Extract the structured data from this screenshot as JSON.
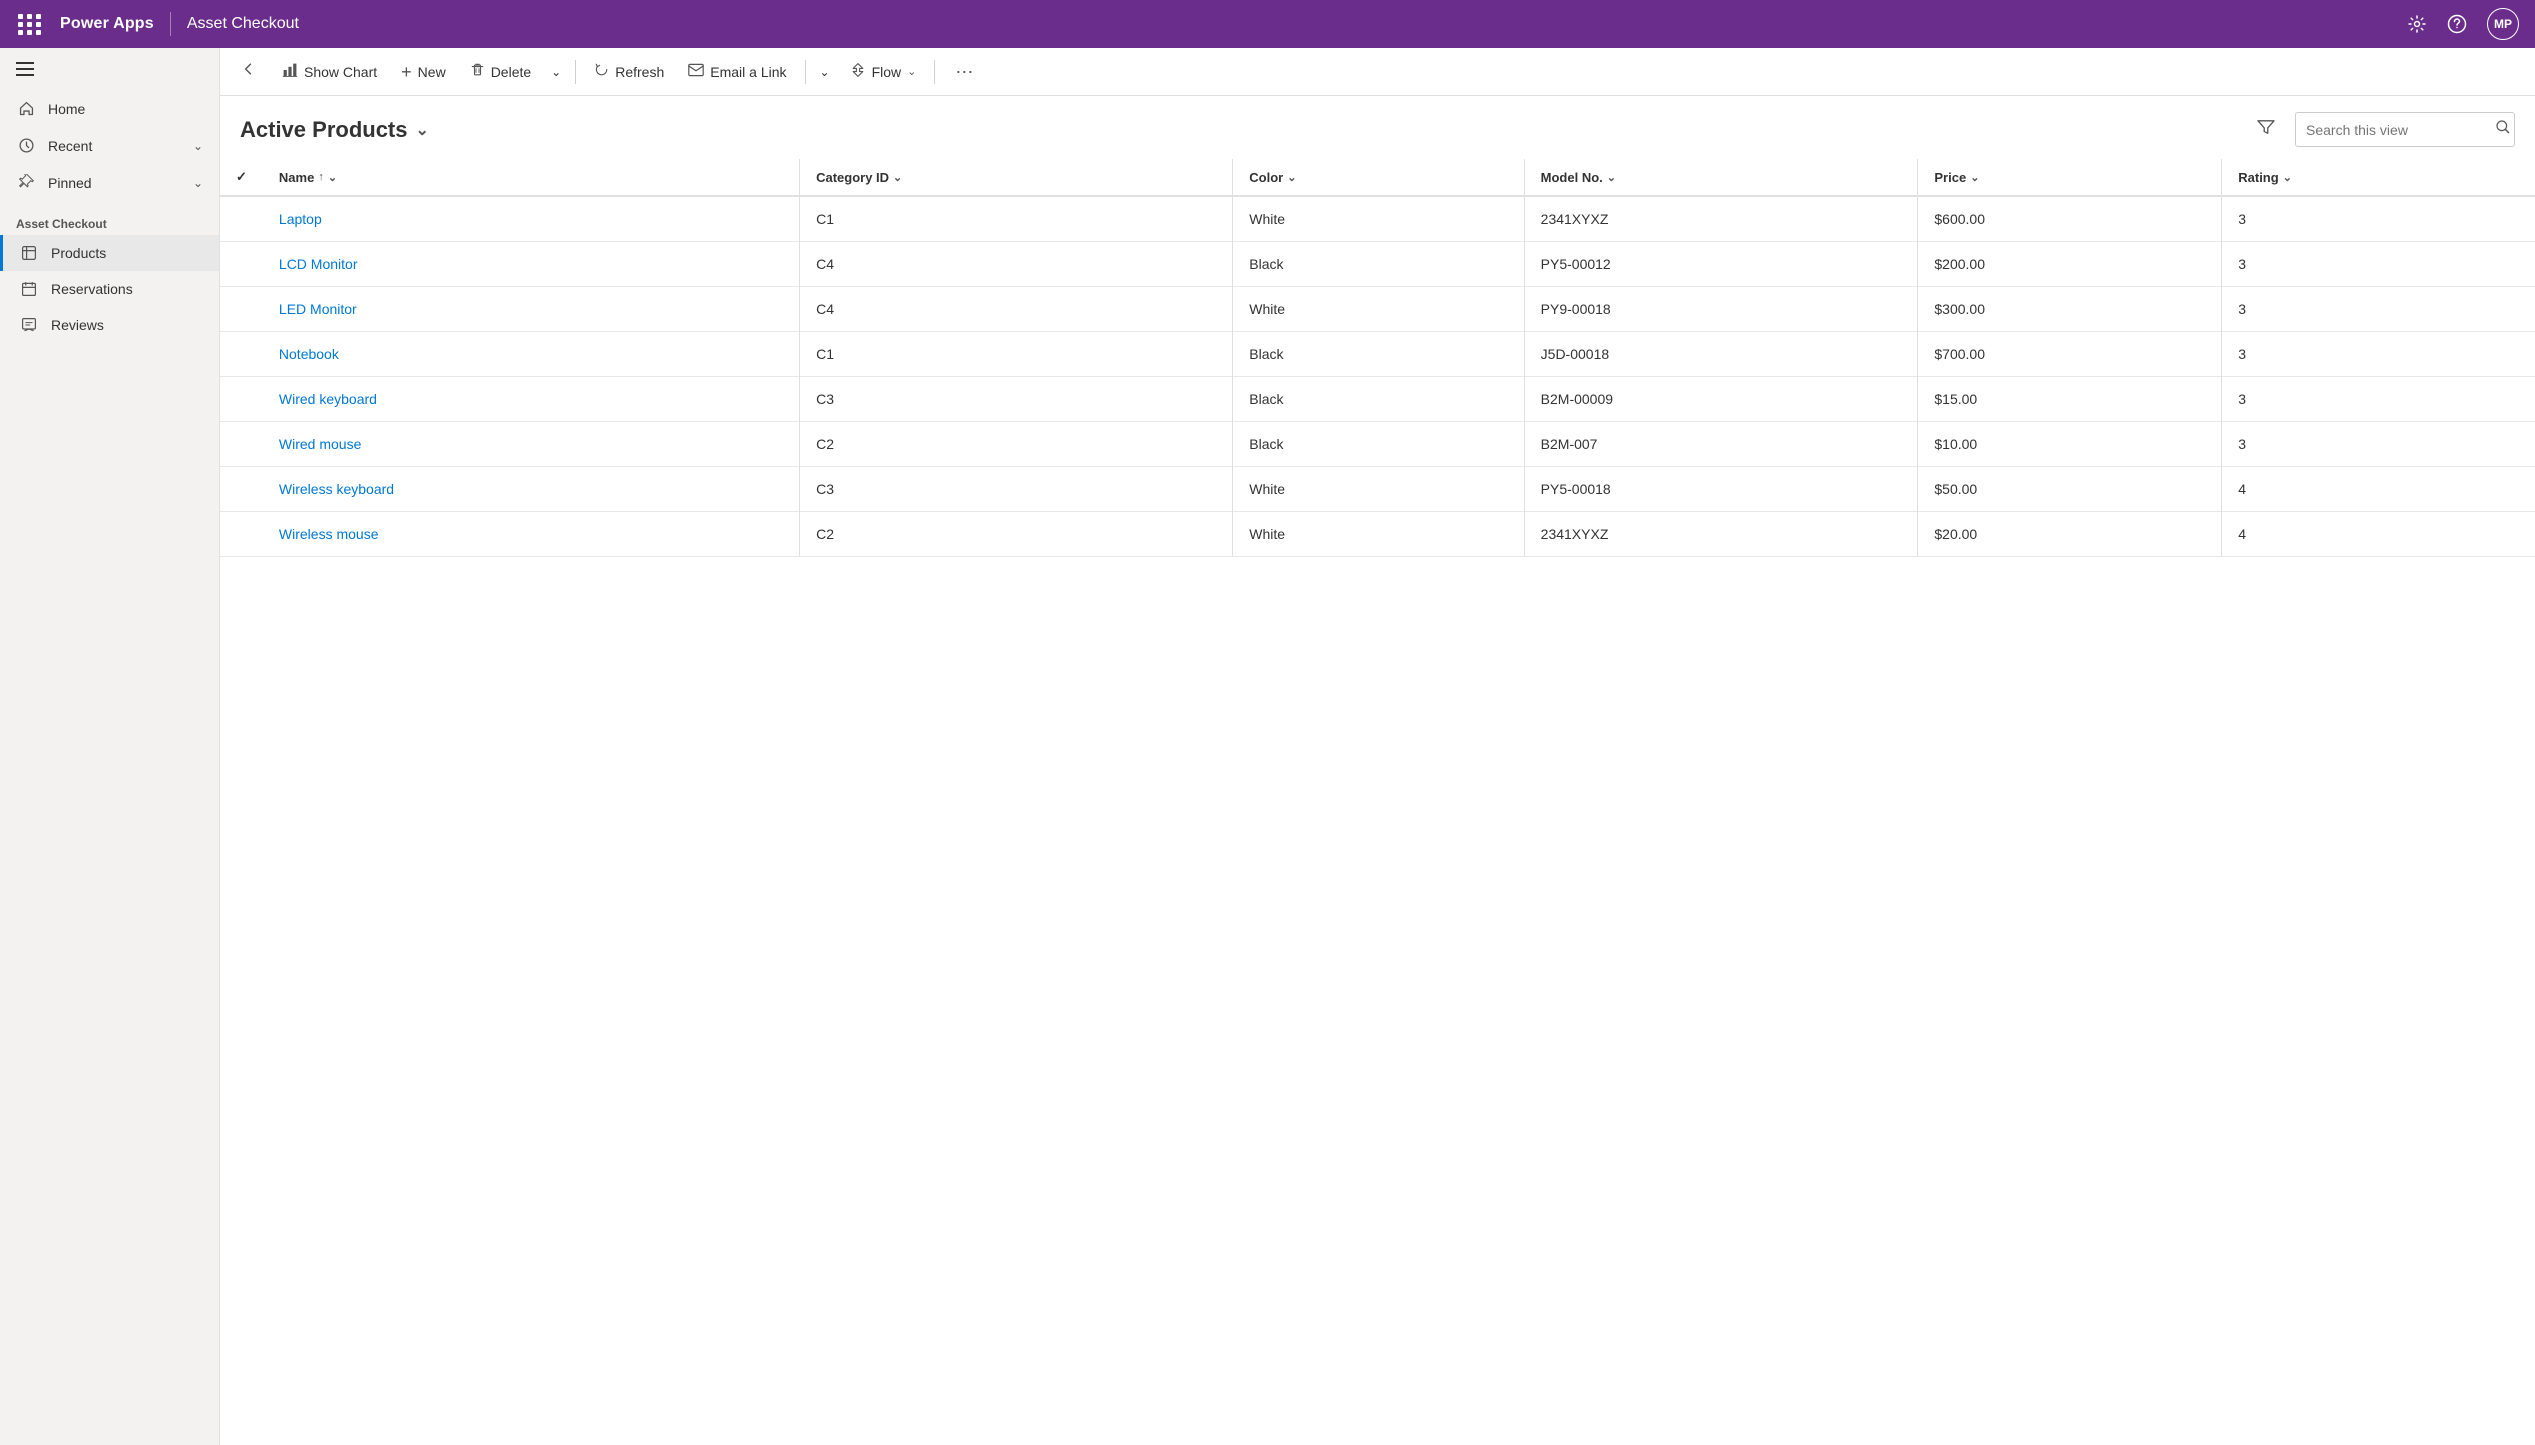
{
  "topbar": {
    "app_name": "Power Apps",
    "page_title": "Asset Checkout",
    "user_initials": "MP",
    "settings_label": "Settings",
    "help_label": "Help"
  },
  "sidebar": {
    "nav_items": [
      {
        "id": "home",
        "label": "Home",
        "icon": "⌂",
        "has_chevron": false
      },
      {
        "id": "recent",
        "label": "Recent",
        "icon": "🕐",
        "has_chevron": true
      },
      {
        "id": "pinned",
        "label": "Pinned",
        "icon": "📌",
        "has_chevron": true
      }
    ],
    "section_label": "Asset Checkout",
    "section_items": [
      {
        "id": "products",
        "label": "Products",
        "icon": "📦",
        "active": true
      },
      {
        "id": "reservations",
        "label": "Reservations",
        "icon": "📋",
        "active": false
      },
      {
        "id": "reviews",
        "label": "Reviews",
        "icon": "📝",
        "active": false
      }
    ]
  },
  "toolbar": {
    "back_label": "←",
    "show_chart_label": "Show Chart",
    "new_label": "New",
    "delete_label": "Delete",
    "refresh_label": "Refresh",
    "email_link_label": "Email a Link",
    "flow_label": "Flow",
    "more_label": "⋯"
  },
  "view": {
    "title": "Active Products",
    "search_placeholder": "Search this view"
  },
  "table": {
    "columns": [
      {
        "id": "name",
        "label": "Name",
        "sortable": true,
        "sort_dir": "asc"
      },
      {
        "id": "category_id",
        "label": "Category ID",
        "sortable": true
      },
      {
        "id": "color",
        "label": "Color",
        "sortable": true
      },
      {
        "id": "model_no",
        "label": "Model No.",
        "sortable": true
      },
      {
        "id": "price",
        "label": "Price",
        "sortable": true
      },
      {
        "id": "rating",
        "label": "Rating",
        "sortable": true
      }
    ],
    "rows": [
      {
        "name": "Laptop",
        "category_id": "C1",
        "color": "White",
        "model_no": "2341XYXZ",
        "price": "$600.00",
        "rating": "3"
      },
      {
        "name": "LCD Monitor",
        "category_id": "C4",
        "color": "Black",
        "model_no": "PY5-00012",
        "price": "$200.00",
        "rating": "3"
      },
      {
        "name": "LED Monitor",
        "category_id": "C4",
        "color": "White",
        "model_no": "PY9-00018",
        "price": "$300.00",
        "rating": "3"
      },
      {
        "name": "Notebook",
        "category_id": "C1",
        "color": "Black",
        "model_no": "J5D-00018",
        "price": "$700.00",
        "rating": "3"
      },
      {
        "name": "Wired keyboard",
        "category_id": "C3",
        "color": "Black",
        "model_no": "B2M-00009",
        "price": "$15.00",
        "rating": "3"
      },
      {
        "name": "Wired mouse",
        "category_id": "C2",
        "color": "Black",
        "model_no": "B2M-007",
        "price": "$10.00",
        "rating": "3"
      },
      {
        "name": "Wireless keyboard",
        "category_id": "C3",
        "color": "White",
        "model_no": "PY5-00018",
        "price": "$50.00",
        "rating": "4"
      },
      {
        "name": "Wireless mouse",
        "category_id": "C2",
        "color": "White",
        "model_no": "2341XYXZ",
        "price": "$20.00",
        "rating": "4"
      }
    ]
  }
}
